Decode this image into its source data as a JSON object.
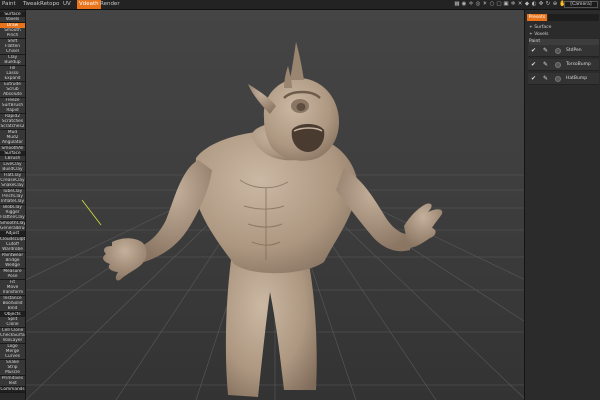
{
  "menubar": {
    "items": [
      {
        "label": "Paint",
        "active": false
      },
      {
        "label": "Tweak",
        "active": false
      },
      {
        "label": "Retopo",
        "active": false
      },
      {
        "label": "UV",
        "active": false
      },
      {
        "label": "Vdeath",
        "active": true
      },
      {
        "label": "Render",
        "active": false
      }
    ],
    "camera_label": "[Camera]"
  },
  "toolbar_icons": [
    "grid-icon",
    "camera-icon",
    "axis-icon",
    "eye-icon",
    "light-icon",
    "circle-icon",
    "frame-icon",
    "box-icon",
    "gear-icon",
    "close-icon",
    "snap-icon",
    "mirror-icon",
    "move-icon",
    "rotate-icon",
    "zoom-icon",
    "pan-icon"
  ],
  "left_tools": [
    {
      "label": "Surface",
      "style": "hdr"
    },
    {
      "label": "Voxels",
      "style": ""
    },
    {
      "label": "Draw",
      "style": "sel"
    },
    {
      "label": "Smooth",
      "style": ""
    },
    {
      "label": "Pinch",
      "style": ""
    },
    {
      "label": "Shift",
      "style": ""
    },
    {
      "label": "Flatten",
      "style": ""
    },
    {
      "label": "Chisel",
      "style": ""
    },
    {
      "label": "Clay",
      "style": ""
    },
    {
      "label": "Buildup",
      "style": ""
    },
    {
      "label": "Fill",
      "style": ""
    },
    {
      "label": "Lasso",
      "style": ""
    },
    {
      "label": "Expand",
      "style": ""
    },
    {
      "label": "Extrude",
      "style": ""
    },
    {
      "label": "Scrub",
      "style": ""
    },
    {
      "label": "Absolute",
      "style": ""
    },
    {
      "label": "Freeze",
      "style": ""
    },
    {
      "label": "SurfBrush",
      "style": ""
    },
    {
      "label": "Rapid",
      "style": ""
    },
    {
      "label": "Rapid2",
      "style": ""
    },
    {
      "label": "Scratches",
      "style": ""
    },
    {
      "label": "Scratches2",
      "style": ""
    },
    {
      "label": "Mud",
      "style": ""
    },
    {
      "label": "Mud2",
      "style": ""
    },
    {
      "label": "Angulator",
      "style": ""
    },
    {
      "label": "SmoothAll",
      "style": ""
    },
    {
      "label": "Surface",
      "style": "hdr"
    },
    {
      "label": "CBrush",
      "style": ""
    },
    {
      "label": "LiveClay",
      "style": ""
    },
    {
      "label": "BuildClay",
      "style": ""
    },
    {
      "label": "FlatClay",
      "style": ""
    },
    {
      "label": "CreaseClay",
      "style": ""
    },
    {
      "label": "SnakeClay",
      "style": ""
    },
    {
      "label": "TubeClay",
      "style": ""
    },
    {
      "label": "PinchClay",
      "style": ""
    },
    {
      "label": "InflateClay",
      "style": ""
    },
    {
      "label": "BlobClay",
      "style": ""
    },
    {
      "label": "Rigger",
      "style": ""
    },
    {
      "label": "FlattenClay",
      "style": ""
    },
    {
      "label": "SmoothClay",
      "style": ""
    },
    {
      "label": "GeneralBrush",
      "style": ""
    },
    {
      "label": "Adjust",
      "style": "hdr"
    },
    {
      "label": "Cloudsculpt",
      "style": ""
    },
    {
      "label": "Cutoff",
      "style": ""
    },
    {
      "label": "Wardrobe",
      "style": ""
    },
    {
      "label": "Paintwear",
      "style": ""
    },
    {
      "label": "Bridge",
      "style": ""
    },
    {
      "label": "Wedge",
      "style": ""
    },
    {
      "label": "Measure",
      "style": ""
    },
    {
      "label": "Pose",
      "style": ""
    },
    {
      "label": "Fit",
      "style": ""
    },
    {
      "label": "Move",
      "style": ""
    },
    {
      "label": "Transform",
      "style": ""
    },
    {
      "label": "Instance",
      "style": ""
    },
    {
      "label": "BoolSolid",
      "style": ""
    },
    {
      "label": "Bind",
      "style": ""
    },
    {
      "label": "Objects",
      "style": "hdr"
    },
    {
      "label": "Split",
      "style": ""
    },
    {
      "label": "Clone",
      "style": ""
    },
    {
      "label": "Cell Clone",
      "style": ""
    },
    {
      "label": "CheckSurface",
      "style": ""
    },
    {
      "label": "VoxLayer",
      "style": ""
    },
    {
      "label": "Logo",
      "style": ""
    },
    {
      "label": "Merge",
      "style": ""
    },
    {
      "label": "Curves",
      "style": ""
    },
    {
      "label": "Snake",
      "style": ""
    },
    {
      "label": "Strip",
      "style": ""
    },
    {
      "label": "Muscle",
      "style": ""
    },
    {
      "label": "Primitives",
      "style": ""
    },
    {
      "label": "Text",
      "style": ""
    },
    {
      "label": "Commands",
      "style": "hdr"
    }
  ],
  "right_panel": {
    "tab_label": "Presets",
    "tree": [
      {
        "label": "+ Surface",
        "selected": false
      },
      {
        "label": "+ Voxels",
        "selected": false
      },
      {
        "label": "Paint",
        "selected": true
      }
    ],
    "layers": [
      {
        "name": "StdPen"
      },
      {
        "name": "TorsoBump"
      },
      {
        "name": "HatBump"
      }
    ]
  },
  "viewport": {
    "model_color": "#b7a28d",
    "grid_color": "#5a5a5a"
  }
}
